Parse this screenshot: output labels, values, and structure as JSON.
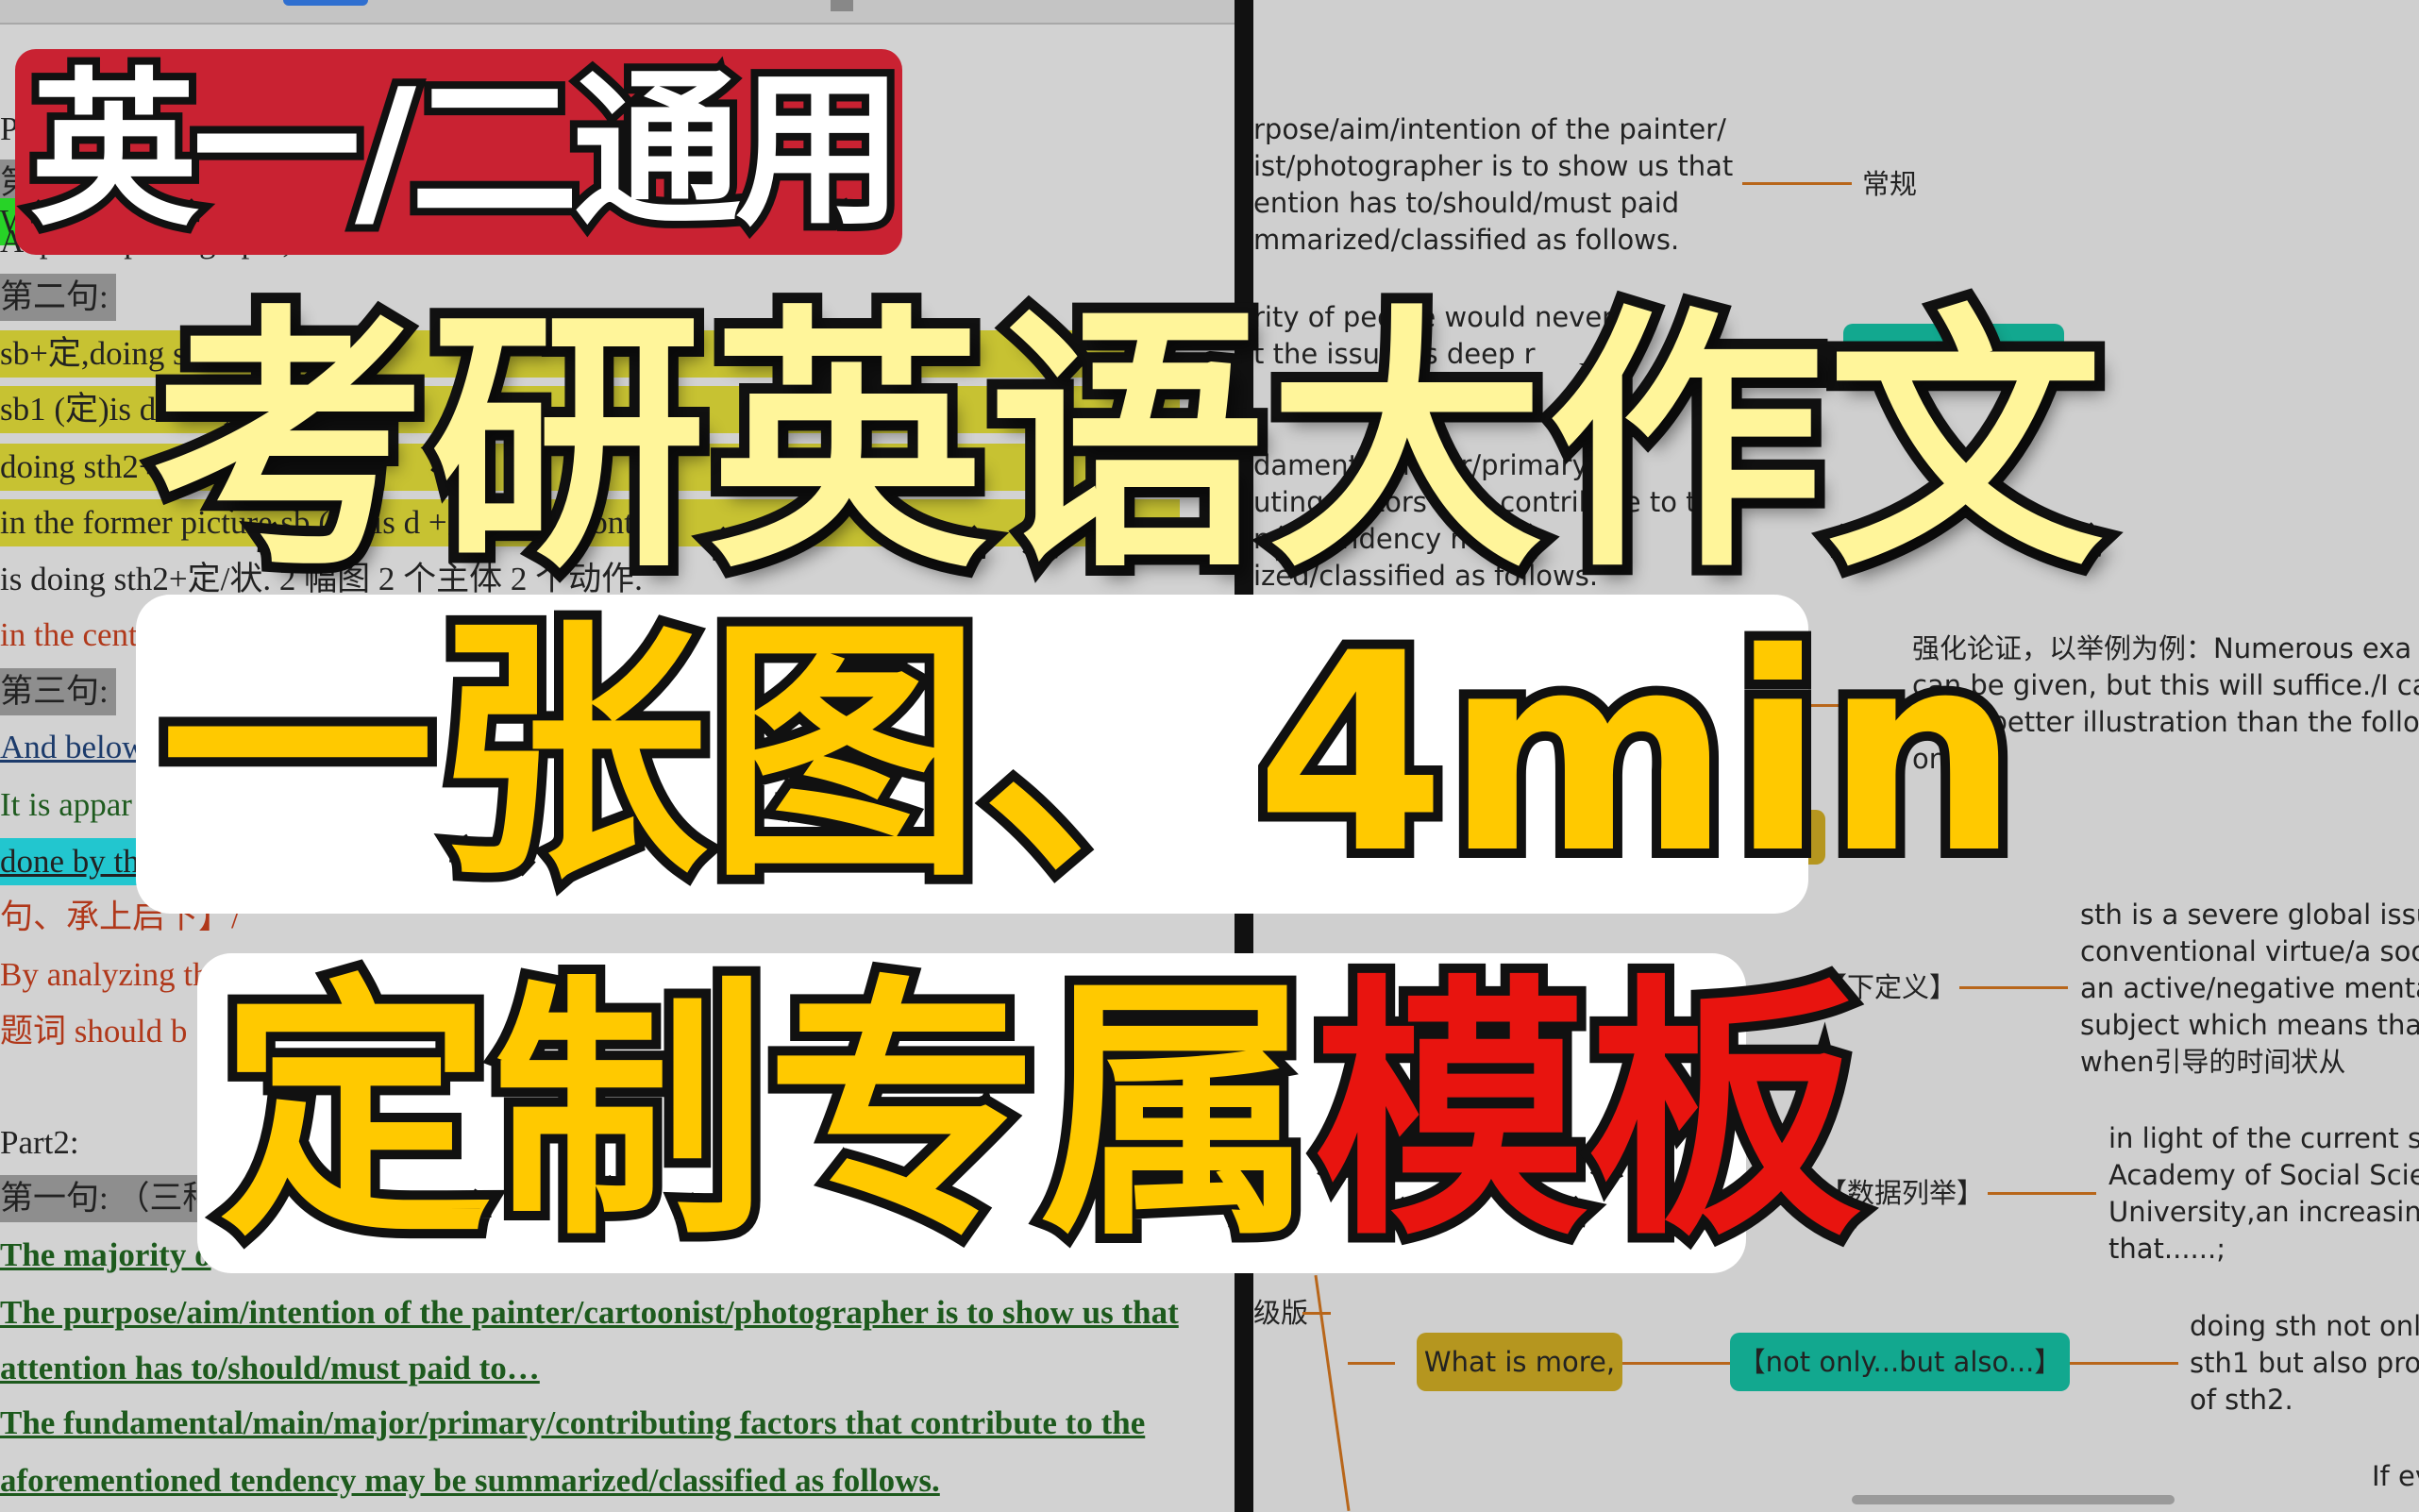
{
  "document": {
    "lines": [
      "P",
      "第",
      "W",
      "A                                                   /photo/photograph ,",
      "第二句:",
      "sb+定,doing sth                                                        ",
      "sb1 (定)is do                                  ure,                   le/",
      "doing sth2+                                                            ",
      "in the former picture sb     (定)is d                +定状, sin               cont",
      "is doing sth2+定/状. 2 幅图 2 个主体 2 个动作.",
      "in the cent",
      "第三句:",
      "And below",
      "It is appar",
      "done by th",
      "句、承上启下】/",
      "By analyzing th",
      "题词  should b",
      "Part2:",
      "第一句: （三种",
      "The majority o",
      "The purpose/aim/intention of the painter/cartoonist/photographer is to show us that",
      "attention has to/should/must paid to…",
      "The fundamental/main/major/primary/contributing factors that contribute to the",
      "aforementioned tendency may be summarized/classified as follows."
    ]
  },
  "mindmap": {
    "block1": [
      "rpose/aim/intention of the painter/",
      "ist/photographer is to show us that",
      "ention has to/should/must paid",
      "mmarized/classified as follows."
    ],
    "label_changgui": "常规",
    "block2": [
      "rity of people would never",
      "t the issue its deep r"
    ],
    "block3": [
      "damental/major/primary/",
      "uting factors that contribute to t",
      "ned tendency may",
      "ized/classified as follows."
    ],
    "block4": [
      "强化论证，以举例为例：Numerous exa",
      "can be given, but this will suffice./I ca",
      "of no better illustration than the follow",
      "one."
    ],
    "label_define": "【下定义】",
    "block5": [
      "sth is a severe global issu",
      "conventional virtue/a soc",
      "an active/negative menta",
      "subject which means that",
      "when引导的时间状从"
    ],
    "label_data": "【数据列举】",
    "block6": [
      "in light of the current su",
      "Academy of Social Scie",
      "University,an increasing",
      "that......;"
    ],
    "label_upgrade": "级版",
    "what_is_more": "What is more,",
    "not_only": "【not only...but also...】",
    "block7": [
      "doing sth not only",
      "sth1 but also prov",
      "of sth2."
    ],
    "if_ev": "If ev",
    "colors": {
      "branch": "#b8661a",
      "olive_box": "#b5961f",
      "teal_box": "#12a88f"
    }
  },
  "overlay": {
    "badge": "英一/二通用",
    "title": "考研英语大作文",
    "line1": "一张图、4min",
    "line2_a": "定制专属",
    "line2_b": "模板",
    "colors": {
      "badge": "#c92232",
      "title": "#fff59a",
      "yellow": "#ffc900",
      "red": "#e8140f"
    }
  }
}
